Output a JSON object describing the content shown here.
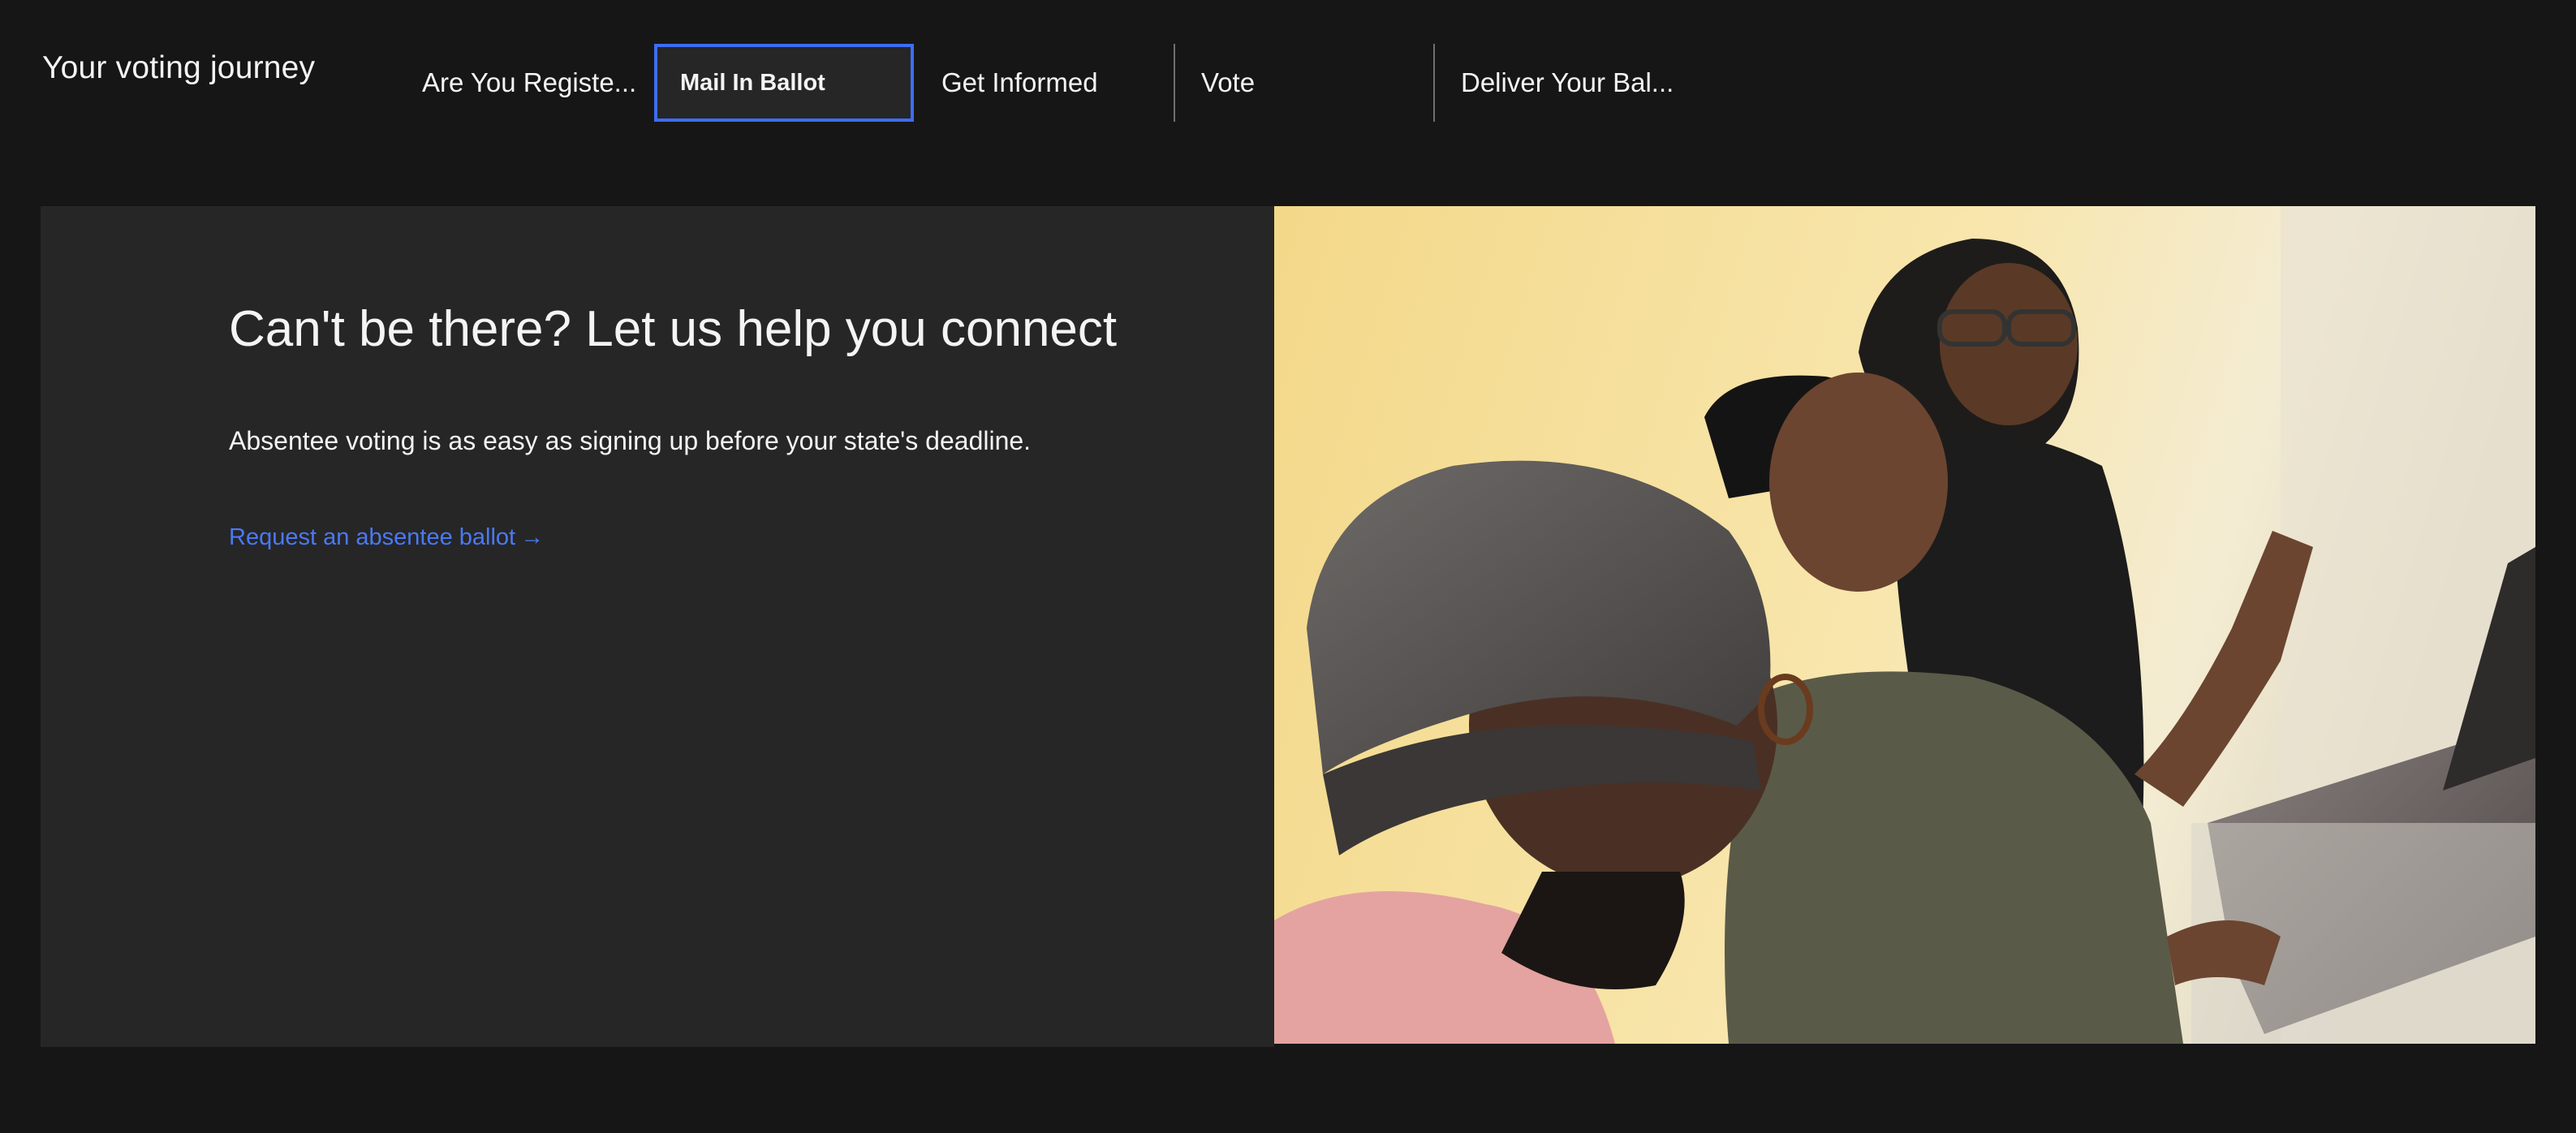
{
  "header": {
    "title": "Your voting journey",
    "tabs": [
      {
        "label": "Are You Registe...",
        "active": false
      },
      {
        "label": "Mail In Ballot",
        "active": true
      },
      {
        "label": "Get Informed",
        "active": false
      },
      {
        "label": "Vote",
        "active": false
      },
      {
        "label": "Deliver Your Bal...",
        "active": false
      }
    ]
  },
  "lead": {
    "heading": "Can't be there? Let us help you connect",
    "body": "Absentee voting is as easy as signing up before your state's deadline.",
    "link_label": "Request an absentee ballot",
    "link_arrow": "→"
  },
  "colors": {
    "page_bg": "#161616",
    "panel_bg": "#262626",
    "accent": "#3d6df2",
    "link": "#4a79f5"
  }
}
